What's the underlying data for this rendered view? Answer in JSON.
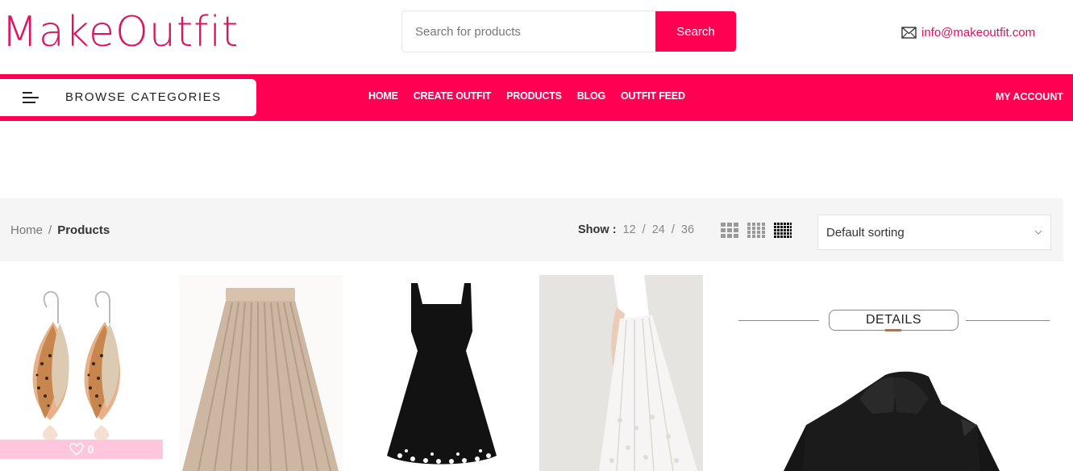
{
  "header": {
    "logo": "MakeOutfit",
    "search_placeholder": "Search for products",
    "search_button": "Search",
    "email": "info@makeoutfit.com"
  },
  "nav": {
    "browse_label": "BROWSE CATEGORIES",
    "links": [
      "HOME",
      "CREATE OUTFIT",
      "PRODUCTS",
      "BLOG",
      "OUTFIT FEED"
    ],
    "account": "MY ACCOUNT",
    "brand_color": "#ff0052"
  },
  "toolbar": {
    "breadcrumb": {
      "home": "Home",
      "separator": "/",
      "current": "Products"
    },
    "show_label": "Show :",
    "show_options": [
      "12",
      "24",
      "36"
    ],
    "show_separator": "/",
    "grid_view_icons": [
      "grid-3-columns-icon",
      "grid-4-columns-icon",
      "grid-6-columns-icon"
    ],
    "grid_view_active": "grid-6-columns-icon",
    "sort_selected": "Default sorting"
  },
  "products": {
    "items": [
      {
        "name": "leather-leaf-earrings",
        "wishlist_count": "0"
      },
      {
        "name": "beige-pleated-skirt"
      },
      {
        "name": "black-sleeveless-dress"
      },
      {
        "name": "white-lace-skirt"
      },
      {
        "name": "black-puffer-jacket",
        "banner_label": "DETAILS"
      }
    ]
  }
}
